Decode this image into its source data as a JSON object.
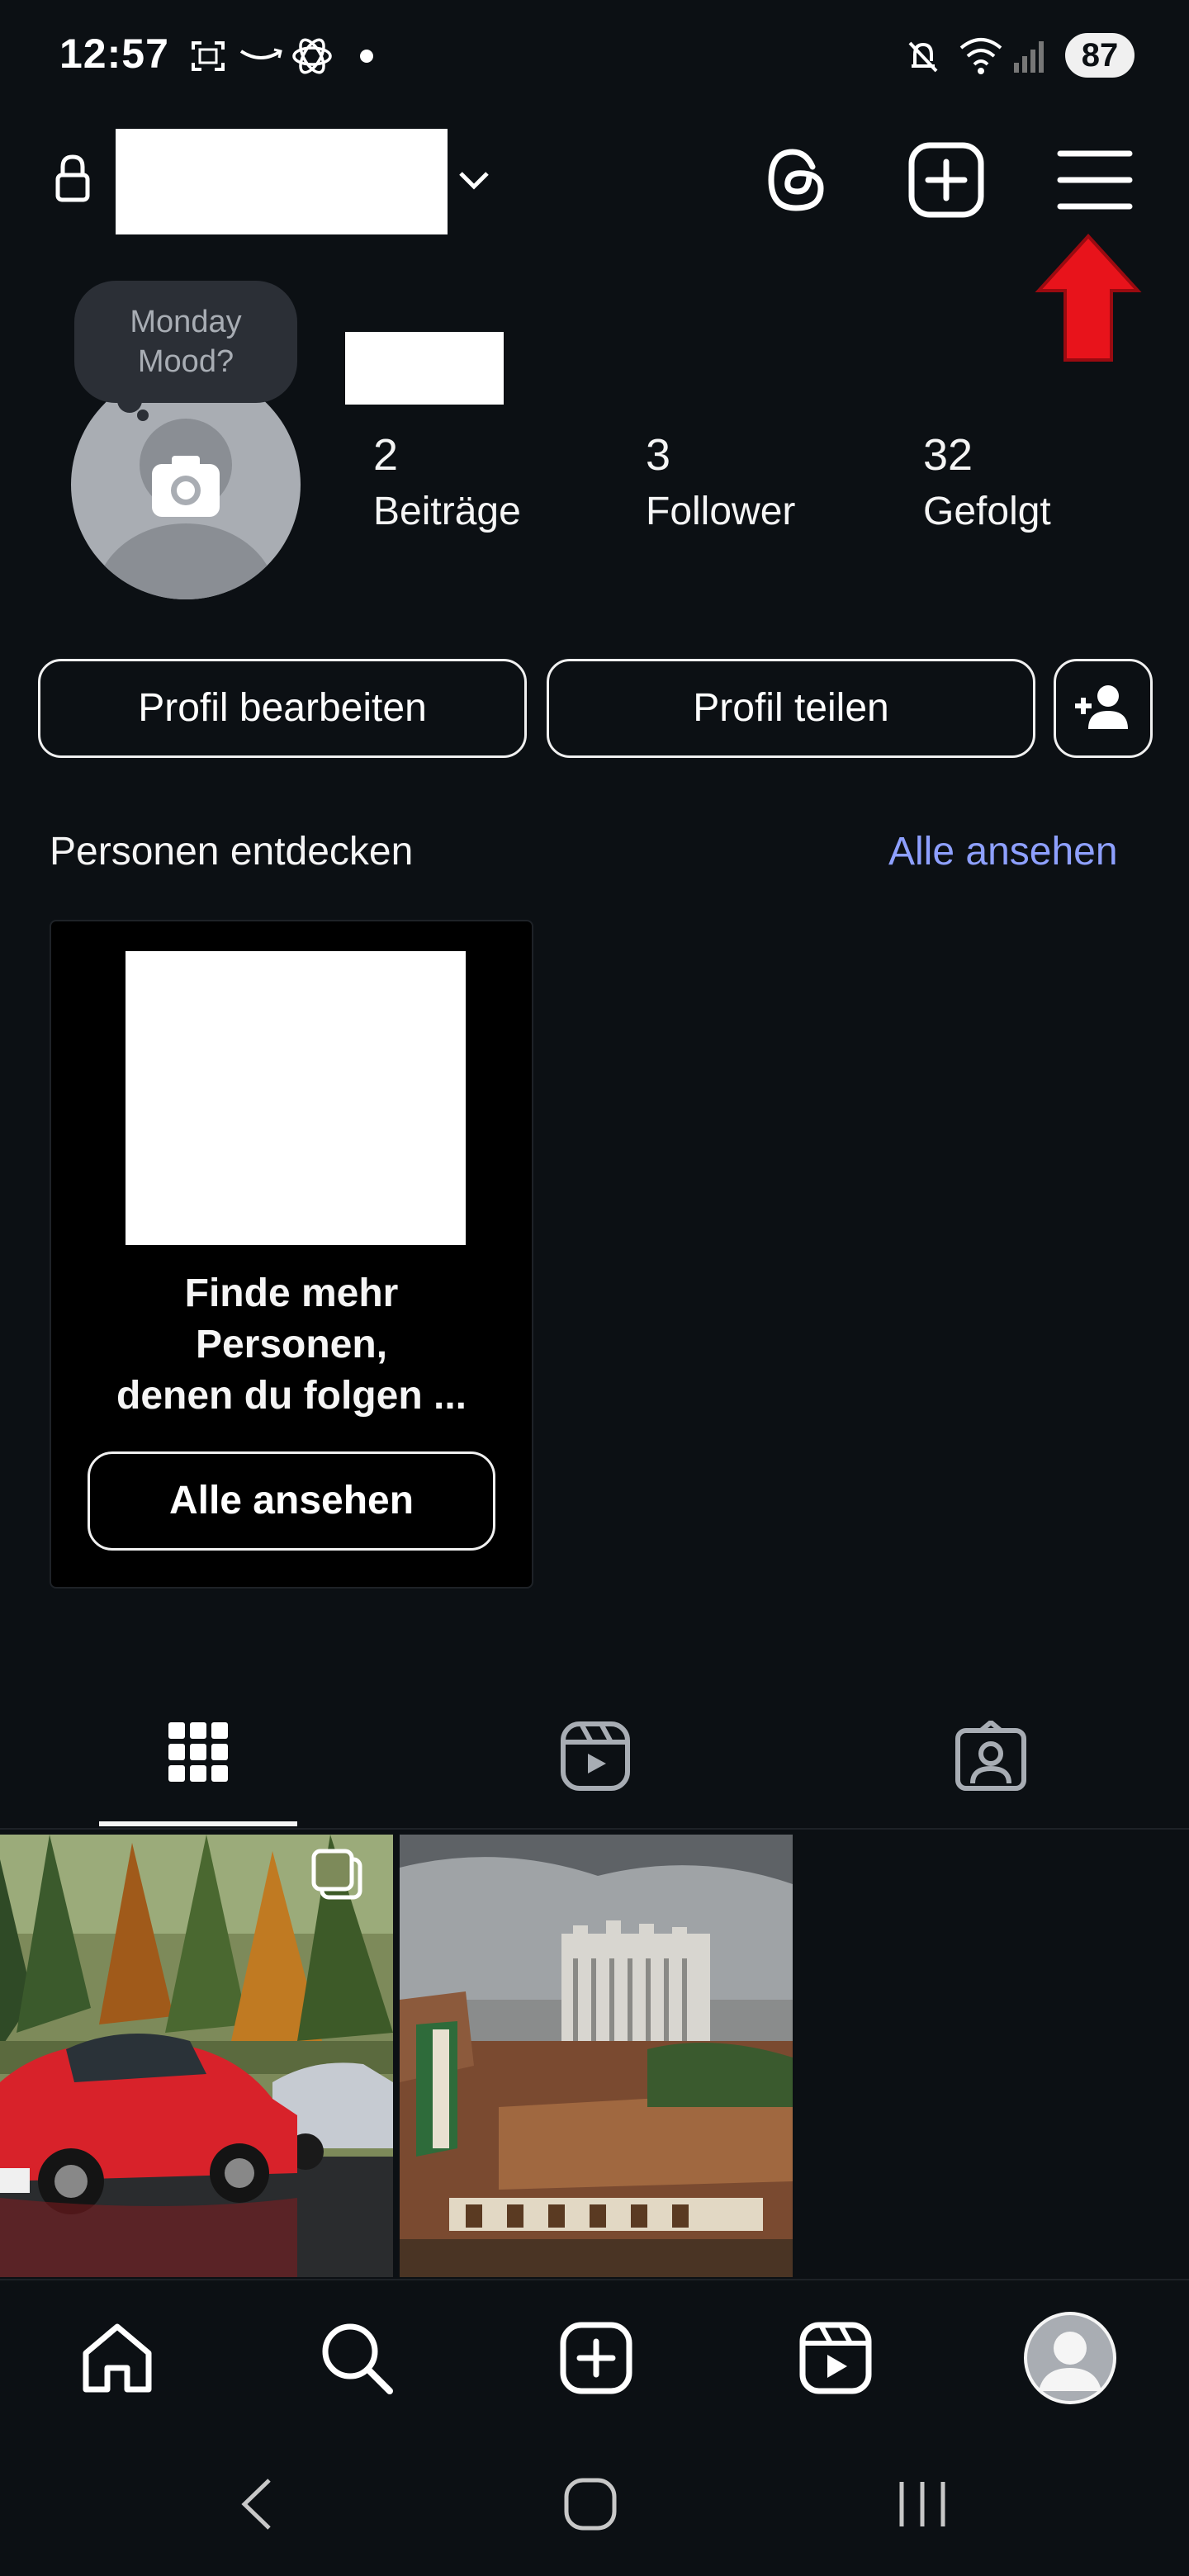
{
  "status_bar": {
    "time": "12:57",
    "battery": "87",
    "icons": [
      "screenshot-icon",
      "amazon-icon",
      "openai-icon",
      "dot-icon",
      "mute-icon",
      "wifi-icon",
      "signal-icon"
    ]
  },
  "header": {
    "icons": [
      "lock-icon",
      "chevron-down-icon",
      "threads-icon",
      "add-post-icon",
      "menu-icon",
      "red-arrow-icon"
    ]
  },
  "profile": {
    "note_line1": "Monday",
    "note_line2": "Mood?",
    "stats": [
      {
        "value": "2",
        "label": "Beiträge"
      },
      {
        "value": "3",
        "label": "Follower"
      },
      {
        "value": "32",
        "label": "Gefolgt"
      }
    ]
  },
  "actions": {
    "edit_profile": "Profil bearbeiten",
    "share_profile": "Profil teilen"
  },
  "discover": {
    "title": "Personen entdecken",
    "see_all": "Alle ansehen",
    "card_line1": "Finde mehr",
    "card_line2": "Personen,",
    "card_line3": "denen du folgen ...",
    "card_button": "Alle ansehen"
  },
  "tabs": [
    "grid-icon",
    "reels-icon",
    "tagged-icon"
  ],
  "bottom_nav": [
    "home-icon",
    "search-icon",
    "create-icon",
    "reels-icon",
    "profile-icon"
  ],
  "colors": {
    "background": "#0c1014",
    "link": "#8ea0ff",
    "arrow": "#e8131b"
  }
}
